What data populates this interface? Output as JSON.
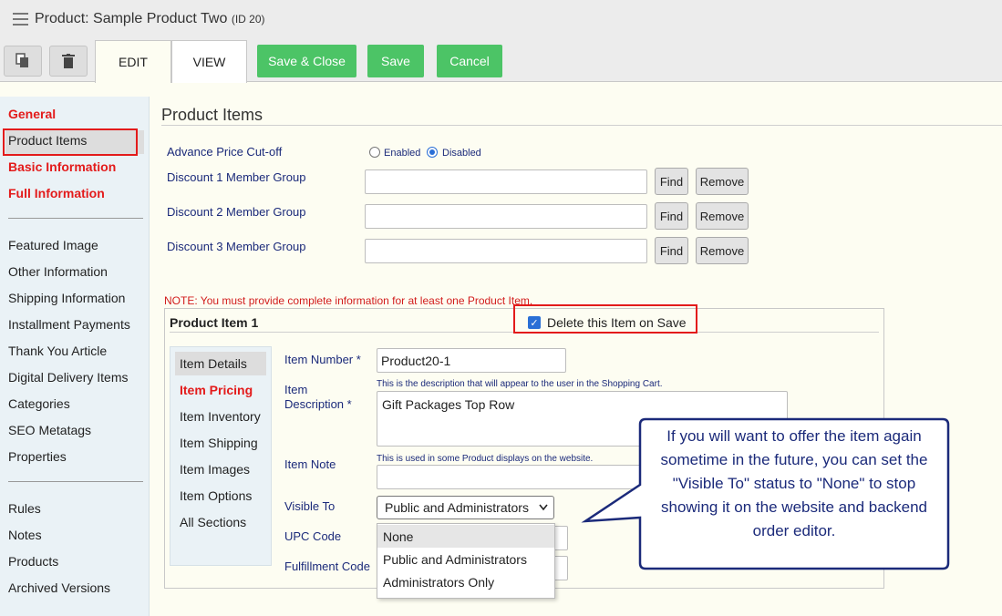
{
  "header": {
    "title": "Product: Sample Product Two",
    "id_label": "(ID 20)"
  },
  "toolbar": {
    "tabs": [
      "EDIT",
      "VIEW"
    ],
    "save_close": "Save & Close",
    "save": "Save",
    "cancel": "Cancel"
  },
  "sidebar": {
    "group1": [
      "General",
      "Product Items",
      "Basic Information",
      "Full Information"
    ],
    "group2": [
      "Featured Image",
      "Other Information",
      "Shipping Information",
      "Installment Payments",
      "Thank You Article",
      "Digital Delivery Items",
      "Categories",
      "SEO Metatags",
      "Properties"
    ],
    "group3": [
      "Rules",
      "Notes",
      "Products",
      "Archived Versions"
    ]
  },
  "main": {
    "section_title": "Product Items",
    "advance_price_label": "Advance Price Cut-off",
    "radio_enabled": "Enabled",
    "radio_disabled": "Disabled",
    "discount_groups": [
      "Discount 1 Member Group",
      "Discount 2 Member Group",
      "Discount 3 Member Group"
    ],
    "find": "Find",
    "remove": "Remove",
    "note": "NOTE: You must provide complete information for at least one Product Item.",
    "item": {
      "title": "Product Item 1",
      "delete_label": "Delete this Item on Save",
      "delete_checked": true,
      "subnav": [
        "Item Details",
        "Item Pricing",
        "Item Inventory",
        "Item Shipping",
        "Item Images",
        "Item Options",
        "All Sections"
      ],
      "item_number_label": "Item Number *",
      "item_number_value": "Product20-1",
      "desc_hint": "This is the description that will appear to the user in the Shopping Cart.",
      "desc_label_1": "Item",
      "desc_label_2": "Description *",
      "desc_value": "Gift Packages Top Row",
      "note_hint": "This is used in some Product displays on the website.",
      "note_label": "Item Note",
      "visible_label": "Visible To",
      "visible_value": "Public and Administrators",
      "visible_options": [
        "None",
        "Public and Administrators",
        "Administrators Only"
      ],
      "upc_label": "UPC Code",
      "fulfillment_label": "Fulfillment Code"
    }
  },
  "callout": {
    "text": "If you will want to offer the item again sometime in the future, you can set the \"Visible To\" status to \"None\" to stop showing it on the website and backend order editor."
  },
  "colors": {
    "accent_green": "#4cc466",
    "highlight_red": "#e31b1b",
    "label_blue": "#1b2a7a",
    "callout_border": "#1b2a7a"
  }
}
